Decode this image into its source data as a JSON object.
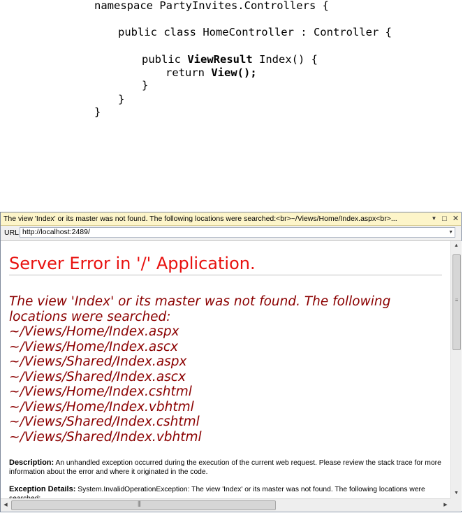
{
  "code": {
    "line1": "namespace PartyInvites.Controllers {",
    "line2": "public class HomeController : Controller {",
    "line3_prefix": "public ",
    "line3_type": "ViewResult",
    "line3_suffix": " Index() {",
    "line4_prefix": "return ",
    "line4_call": "View();",
    "brace": "}"
  },
  "window": {
    "title": "The view 'Index' or its master was not found. The following locations were searched:<br>~/Views/Home/Index.aspx<br>...",
    "dropdown_icon": "▼",
    "restore_icon": "□",
    "close_icon": "✕",
    "url_label": "URL:",
    "url_value": "http://localhost:2489/"
  },
  "page": {
    "heading": "Server Error in '/' Application.",
    "message_lines": [
      "The view 'Index' or its master was not found. The following",
      "locations were searched:",
      "~/Views/Home/Index.aspx",
      "~/Views/Home/Index.ascx",
      "~/Views/Shared/Index.aspx",
      "~/Views/Shared/Index.ascx",
      "~/Views/Home/Index.cshtml",
      "~/Views/Home/Index.vbhtml",
      "~/Views/Shared/Index.cshtml",
      "~/Views/Shared/Index.vbhtml"
    ],
    "description_label": "Description:",
    "description_text": " An unhandled exception occurred during the execution of the current web request. Please review the stack trace for more information about the error and where it originated in the code.",
    "exception_label": "Exception Details:",
    "exception_text": " System.InvalidOperationException: The view 'Index' or its master was not found. The following locations were searched:"
  },
  "scrollbar": {
    "up": "▲",
    "down": "▼",
    "left": "◀",
    "right": "▶",
    "grip_v": "≡",
    "grip_h": "|||"
  }
}
